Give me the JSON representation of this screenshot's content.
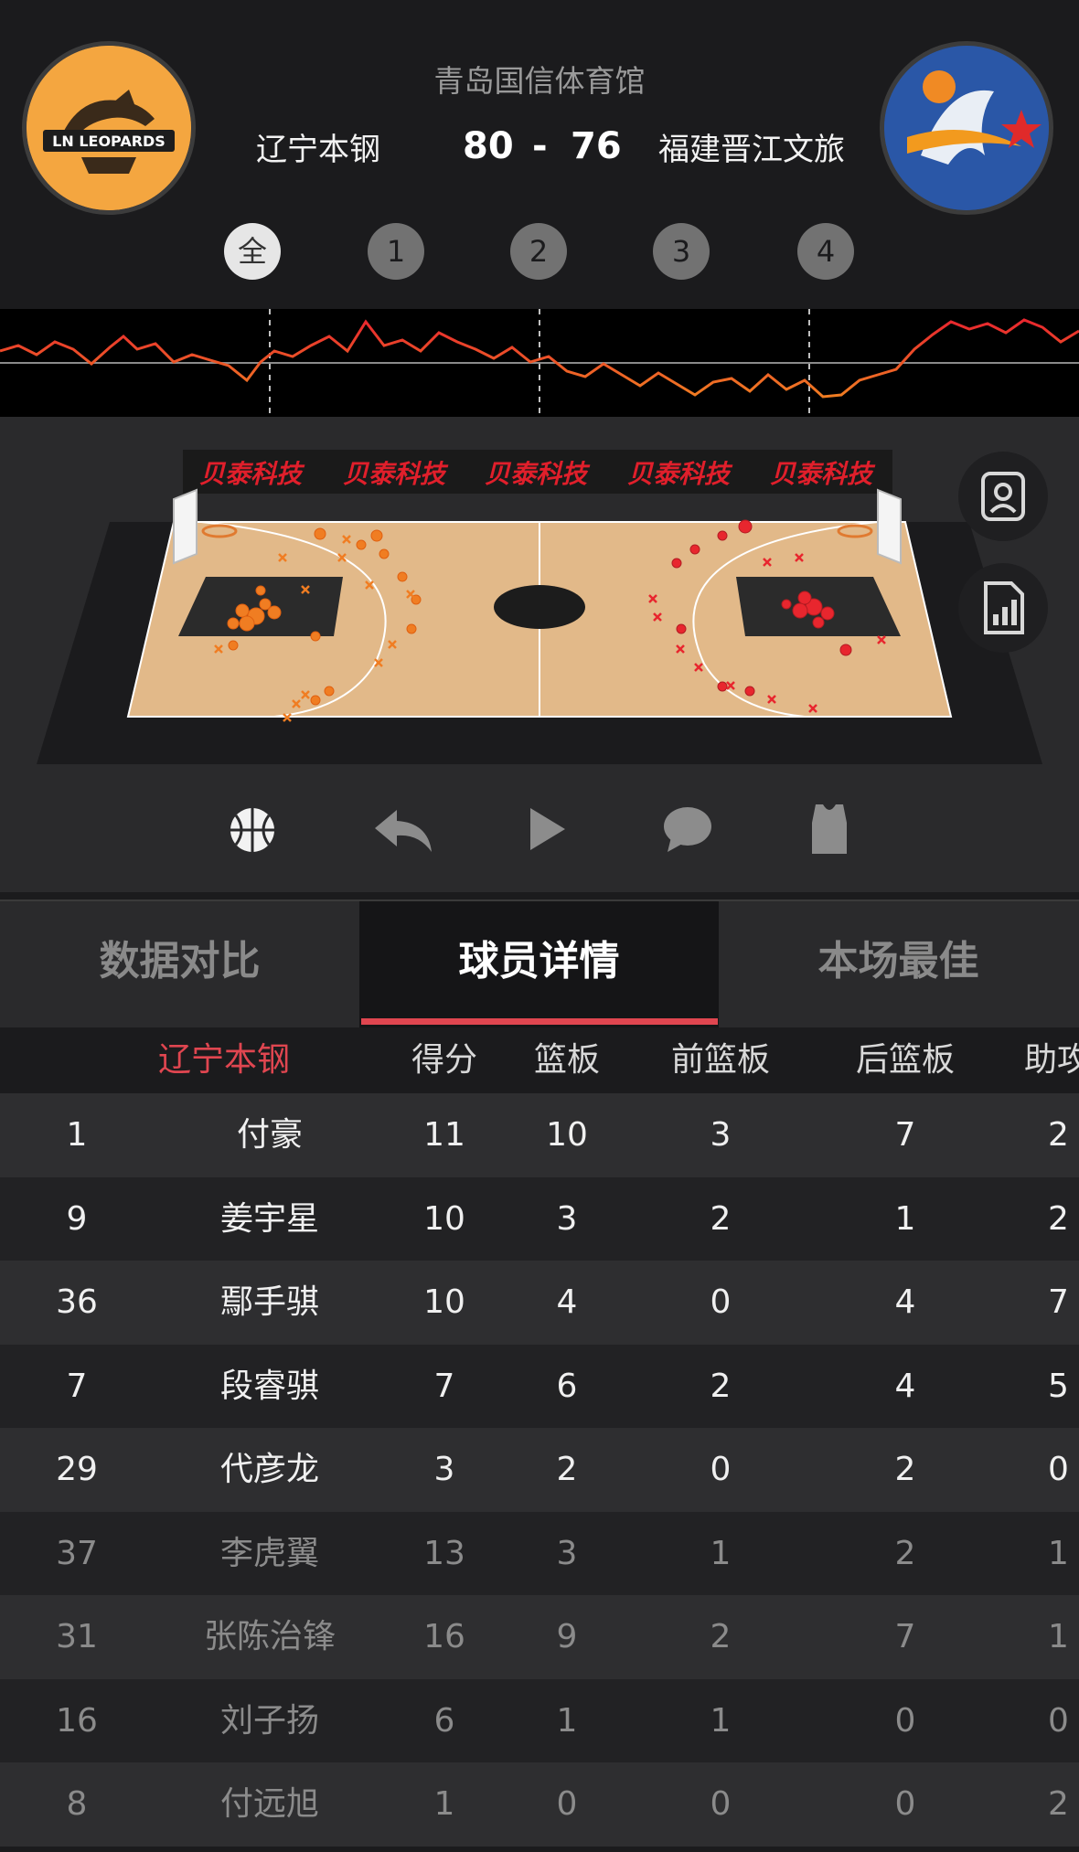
{
  "header": {
    "venue": "青岛国信体育馆",
    "home": {
      "name": "辽宁本钢",
      "score": "80",
      "logo_text": "LN LEOPARDS"
    },
    "away": {
      "name": "福建晋江文旅",
      "score": "76"
    },
    "separator": "-",
    "quarters": [
      "全",
      "1",
      "2",
      "3",
      "4"
    ],
    "active_quarter": "全"
  },
  "court": {
    "sponsor_boards": [
      "贝泰科技",
      "贝泰科技",
      "贝泰科技",
      "贝泰科技",
      "贝泰科技"
    ],
    "side_buttons": [
      "player-card-icon",
      "stats-report-icon"
    ],
    "colors": {
      "home": "#f07d22",
      "away": "#e8262e",
      "floor": "#e2b989",
      "paint": "#2b2b2b"
    }
  },
  "controls": [
    "basketball-icon",
    "replay-icon",
    "play-icon",
    "comment-icon",
    "jersey-icon"
  ],
  "tabs": [
    {
      "label": "数据对比"
    },
    {
      "label": "球员详情"
    },
    {
      "label": "本场最佳"
    }
  ],
  "active_tab": "球员详情",
  "table": {
    "team": "辽宁本钢",
    "headers": {
      "pts": "得分",
      "reb": "篮板",
      "oreb": "前篮板",
      "dreb": "后篮板",
      "ast": "助攻"
    },
    "rows": [
      {
        "num": "1",
        "name": "付豪",
        "pts": "11",
        "reb": "10",
        "oreb": "3",
        "dreb": "7",
        "ast": "2",
        "starter": true
      },
      {
        "num": "9",
        "name": "姜宇星",
        "pts": "10",
        "reb": "3",
        "oreb": "2",
        "dreb": "1",
        "ast": "2",
        "starter": true
      },
      {
        "num": "36",
        "name": "鄢手骐",
        "pts": "10",
        "reb": "4",
        "oreb": "0",
        "dreb": "4",
        "ast": "7",
        "starter": true
      },
      {
        "num": "7",
        "name": "段睿骐",
        "pts": "7",
        "reb": "6",
        "oreb": "2",
        "dreb": "4",
        "ast": "5",
        "starter": true
      },
      {
        "num": "29",
        "name": "代彦龙",
        "pts": "3",
        "reb": "2",
        "oreb": "0",
        "dreb": "2",
        "ast": "0",
        "starter": true
      },
      {
        "num": "37",
        "name": "李虎翼",
        "pts": "13",
        "reb": "3",
        "oreb": "1",
        "dreb": "2",
        "ast": "1",
        "starter": false
      },
      {
        "num": "31",
        "name": "张陈治锋",
        "pts": "16",
        "reb": "9",
        "oreb": "2",
        "dreb": "7",
        "ast": "1",
        "starter": false
      },
      {
        "num": "16",
        "name": "刘子扬",
        "pts": "6",
        "reb": "1",
        "oreb": "1",
        "dreb": "0",
        "ast": "0",
        "starter": false
      },
      {
        "num": "8",
        "name": "付远旭",
        "pts": "1",
        "reb": "0",
        "oreb": "0",
        "dreb": "0",
        "ast": "2",
        "starter": false
      }
    ]
  },
  "accent": "#e04650"
}
